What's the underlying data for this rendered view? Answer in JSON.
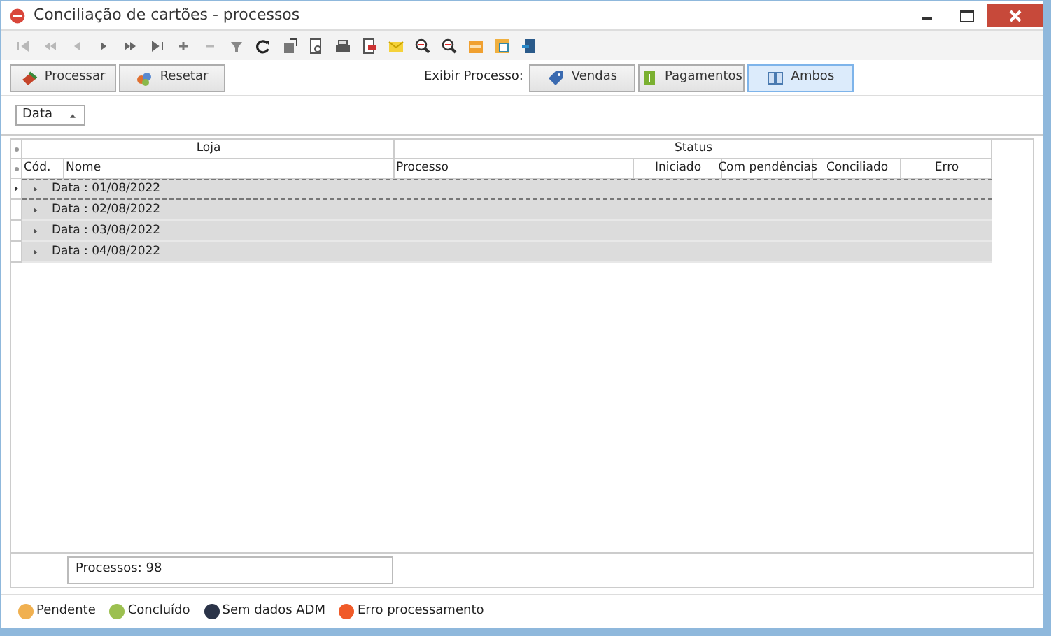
{
  "window": {
    "title": "Conciliação de cartões - processos"
  },
  "actions": [
    {
      "label": "Processar"
    },
    {
      "label": "Resetar"
    }
  ],
  "view_filter": {
    "label": "Exibir Processo:",
    "options": [
      {
        "label": "Vendas",
        "selected": false
      },
      {
        "label": "Pagamentos",
        "selected": false
      },
      {
        "label": "Ambos",
        "selected": true
      }
    ]
  },
  "group_by": [
    {
      "label": "Data"
    }
  ],
  "grid": {
    "bands": [
      {
        "label": "Loja"
      },
      {
        "label": "Status"
      }
    ],
    "columns": [
      "Cód.",
      "Nome",
      "Processo",
      "Iniciado",
      "Com pendências",
      "Conciliado",
      "Erro"
    ],
    "groups": [
      {
        "label": "Data : 01/08/2022",
        "focused": true
      },
      {
        "label": "Data : 02/08/2022",
        "focused": false
      },
      {
        "label": "Data : 03/08/2022",
        "focused": false
      },
      {
        "label": "Data : 04/08/2022",
        "focused": false
      }
    ]
  },
  "footer": {
    "summary": "Processos: 98"
  },
  "legend": [
    {
      "label": "Pendente",
      "color": "#f0b050"
    },
    {
      "label": "Concluído",
      "color": "#9cc050"
    },
    {
      "label": "Sem dados ADM",
      "color": "#2a3348"
    },
    {
      "label": "Erro processamento",
      "color": "#f05a28"
    }
  ]
}
